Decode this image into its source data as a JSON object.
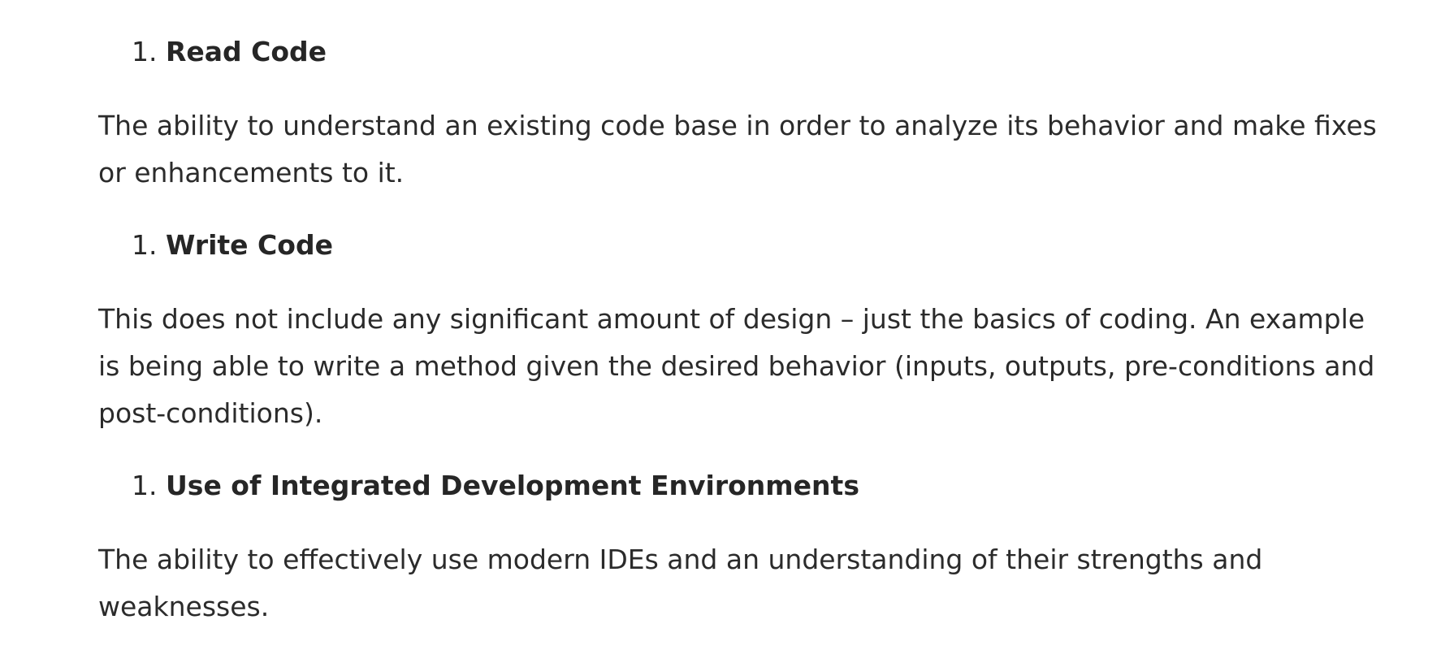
{
  "sections": [
    {
      "number": "1.",
      "heading": "Read Code",
      "paragraph_lines": [
        "The ability to understand an existing code base in order to analyze its behavior and make fixes",
        "or enhancements to it."
      ]
    },
    {
      "number": "1.",
      "heading": "Write Code",
      "paragraph_lines": [
        "This does not include any significant amount of design – just the basics of coding. An example",
        "is being able to write a method given the desired behavior (inputs, outputs, pre-conditions and",
        "post-conditions)."
      ]
    },
    {
      "number": "1.",
      "heading": "Use of Integrated Development Environments",
      "paragraph_lines": [
        "The ability to effectively use modern IDEs and an understanding of their strengths and",
        "weaknesses."
      ]
    }
  ]
}
